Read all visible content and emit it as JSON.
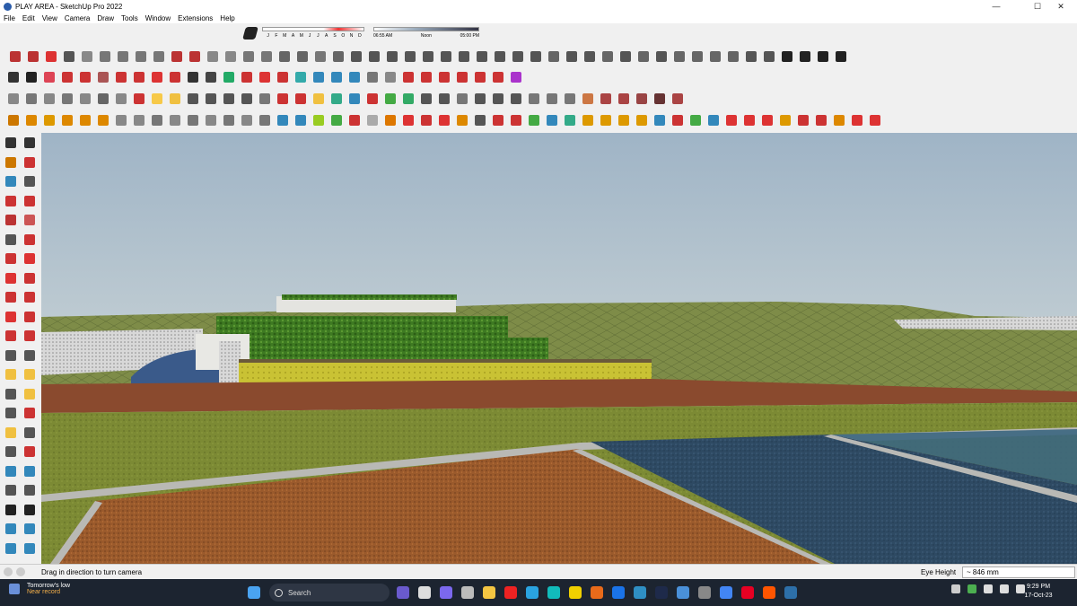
{
  "window": {
    "title": "PLAY AREA - SketchUp Pro 2022",
    "controls": {
      "minimize": "—",
      "maximize": "☐",
      "close": "✕"
    }
  },
  "menu": [
    "File",
    "Edit",
    "View",
    "Camera",
    "Draw",
    "Tools",
    "Window",
    "Extensions",
    "Help"
  ],
  "shadow": {
    "months": [
      "J",
      "F",
      "M",
      "A",
      "M",
      "J",
      "J",
      "A",
      "S",
      "O",
      "N",
      "D"
    ],
    "time_start": "06:55 AM",
    "time_mid": "Noon",
    "time_end": "05:00 PM"
  },
  "toolbar_colors": {
    "row1": [
      "#b33",
      "#b33",
      "#d33",
      "#555",
      "#888",
      "#777",
      "#777",
      "#777",
      "#777",
      "#b33",
      "#b33",
      "#888",
      "#888",
      "#777",
      "#777",
      "#666",
      "#666",
      "#777",
      "#666",
      "#555",
      "#555",
      "#555",
      "#555",
      "#555",
      "#555",
      "#555",
      "#555",
      "#555",
      "#555",
      "#555",
      "#666",
      "#555",
      "#555",
      "#666",
      "#555",
      "#666",
      "#555",
      "#666",
      "#666",
      "#666",
      "#666",
      "#555",
      "#555",
      "#222",
      "#222",
      "#222",
      "#222"
    ],
    "row2": [
      "#333",
      "#222",
      "#d45",
      "#c33",
      "#c33",
      "#a55",
      "#c33",
      "#c33",
      "#d33",
      "#c33",
      "#333",
      "#444",
      "#2a6",
      "#c33",
      "#d33",
      "#c33",
      "#3aa",
      "#38b",
      "#38b",
      "#38b",
      "#777",
      "#888",
      "#c33",
      "#c33",
      "#c33",
      "#c33",
      "#c33",
      "#c33",
      "#a3c"
    ],
    "row3": [
      "#888",
      "#777",
      "#888",
      "#777",
      "#888",
      "#666",
      "#888",
      "#c33",
      "#f7c948",
      "#f0c040",
      "#555",
      "#555",
      "#555",
      "#555",
      "#777",
      "#c33",
      "#c33",
      "#f0c040",
      "#3a8",
      "#38b",
      "#c33",
      "#4a4",
      "#3a6",
      "#555",
      "#555",
      "#777",
      "#555",
      "#555",
      "#555",
      "#777",
      "#777",
      "#777",
      "#c74",
      "#a44",
      "#a44",
      "#944",
      "#633",
      "#a44"
    ],
    "row4": [
      "#c70",
      "#d80",
      "#d90",
      "#d80",
      "#d80",
      "#d80",
      "#888",
      "#888",
      "#777",
      "#888",
      "#777",
      "#888",
      "#777",
      "#888",
      "#777",
      "#38b",
      "#38b",
      "#9c2",
      "#4a4",
      "#c33",
      "#aaa",
      "#d70",
      "#d33",
      "#c33",
      "#d33",
      "#d80",
      "#555",
      "#c33",
      "#c33",
      "#4a4",
      "#38b",
      "#3a8",
      "#d90",
      "#d90",
      "#d90",
      "#d90",
      "#38b",
      "#c33",
      "#4a4",
      "#38b",
      "#d33",
      "#d33",
      "#d33",
      "#d90",
      "#c33",
      "#c33",
      "#d80",
      "#d33",
      "#d33"
    ]
  },
  "left_tool_colors": [
    "#333",
    "#333",
    "#c70",
    "#c33",
    "#38b",
    "#555",
    "#c33",
    "#c33",
    "#b33",
    "#c55",
    "#555",
    "#c33",
    "#c33",
    "#d33",
    "#d33",
    "#c33",
    "#c33",
    "#c33",
    "#d33",
    "#c33",
    "#c33",
    "#c33",
    "#555",
    "#555",
    "#f0c040",
    "#f0c040",
    "#555",
    "#f0c040",
    "#555",
    "#c33",
    "#f0c040",
    "#555",
    "#555",
    "#c33",
    "#38b",
    "#38b",
    "#555",
    "#555",
    "#222",
    "#222",
    "#38b",
    "#38b",
    "#38b",
    "#38b"
  ],
  "status": {
    "hint": "Drag in direction to turn camera",
    "eye_height_label": "Eye Height",
    "eye_height_value": "~ 846 mm"
  },
  "taskbar": {
    "weather_line1": "Tomorrow's low",
    "weather_line2": "Near record",
    "search_placeholder": "Search",
    "time": "9:29 PM",
    "date": "17-Oct-23"
  }
}
